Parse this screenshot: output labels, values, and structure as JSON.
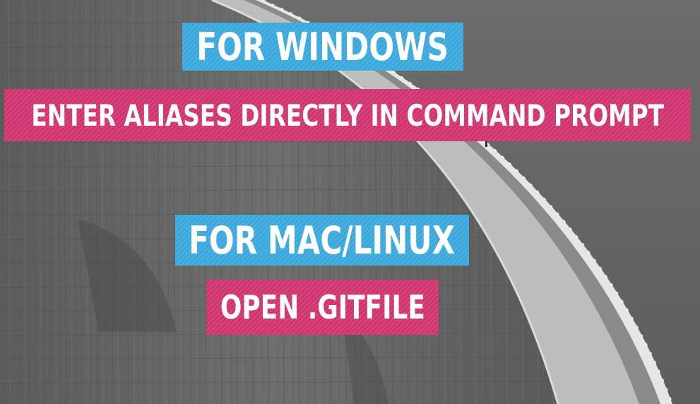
{
  "slide": {
    "windows": {
      "title": "FOR WINDOWS",
      "subtitle": "ENTER ALIASES DIRECTLY IN COMMAND PROMPT"
    },
    "maclinux": {
      "title": "FOR MAC/LINUX",
      "subtitle": "OPEN .GITFILE"
    }
  },
  "colors": {
    "heading_bg": "#3aa8dc",
    "subheading_bg": "#d0336e",
    "text": "#ffffff"
  }
}
